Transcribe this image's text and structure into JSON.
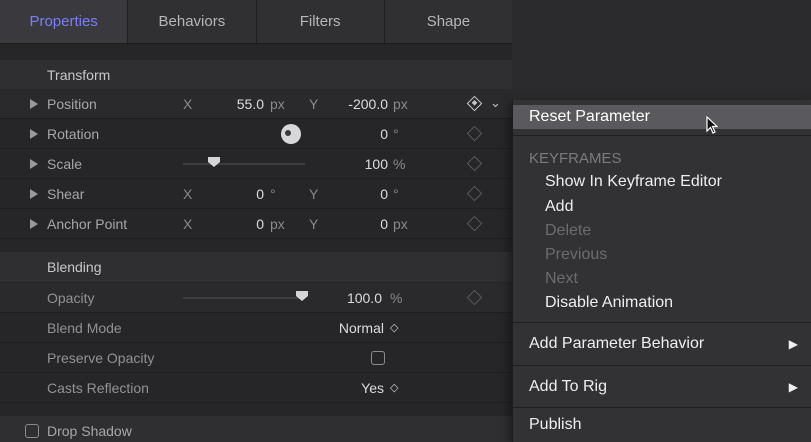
{
  "tabs": [
    "Properties",
    "Behaviors",
    "Filters",
    "Shape"
  ],
  "sections": {
    "transform": "Transform",
    "blending": "Blending"
  },
  "params": {
    "position": {
      "label": "Position",
      "x_axis": "X",
      "x_value": "55.0",
      "x_unit": "px",
      "y_axis": "Y",
      "y_value": "-200.0",
      "y_unit": "px"
    },
    "rotation": {
      "label": "Rotation",
      "value": "0",
      "unit": "°"
    },
    "scale": {
      "label": "Scale",
      "value": "100",
      "unit": "%"
    },
    "shear": {
      "label": "Shear",
      "x_axis": "X",
      "x_value": "0",
      "x_unit": "°",
      "y_axis": "Y",
      "y_value": "0",
      "y_unit": "°"
    },
    "anchor": {
      "label": "Anchor Point",
      "x_axis": "X",
      "x_value": "0",
      "x_unit": "px",
      "y_axis": "Y",
      "y_value": "0",
      "y_unit": "px"
    },
    "opacity": {
      "label": "Opacity",
      "value": "100.0",
      "unit": "%"
    },
    "blend_mode": {
      "label": "Blend Mode",
      "value": "Normal",
      "stepper": "◇"
    },
    "preserve_opacity": {
      "label": "Preserve Opacity"
    },
    "casts_reflection": {
      "label": "Casts Reflection",
      "value": "Yes",
      "stepper": "◇"
    },
    "drop_shadow": {
      "label": "Drop Shadow"
    }
  },
  "menu": {
    "reset": "Reset Parameter",
    "keyframes_header": "KEYFRAMES",
    "show_in_editor": "Show In Keyframe Editor",
    "add": "Add",
    "delete": "Delete",
    "previous": "Previous",
    "next": "Next",
    "disable_animation": "Disable Animation",
    "add_param_behavior": "Add Parameter Behavior",
    "add_to_rig": "Add To Rig",
    "publish": "Publish"
  },
  "colors": {
    "accent_tab": "#7a7dff",
    "menu_highlight": "#5a5a5e"
  }
}
